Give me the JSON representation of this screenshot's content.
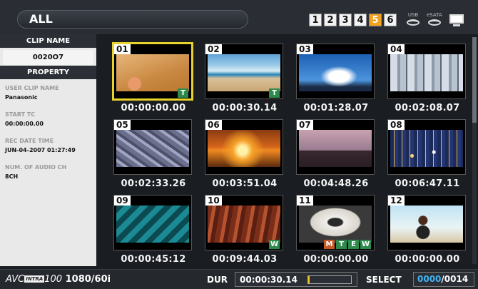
{
  "header": {
    "mode_label": "ALL",
    "slots": [
      {
        "label": "1",
        "active": false
      },
      {
        "label": "2",
        "active": false
      },
      {
        "label": "3",
        "active": false
      },
      {
        "label": "4",
        "active": false
      },
      {
        "label": "5",
        "active": true
      },
      {
        "label": "6",
        "active": false
      }
    ],
    "usb_label": "USB",
    "esata_label": "eSATA"
  },
  "left_panel": {
    "clip_name_header": "CLIP NAME",
    "clip_name_value": "0020O7",
    "property_header": "PROPERTY",
    "properties": [
      {
        "key": "USER CLIP NAME",
        "value": "Panasonic"
      },
      {
        "key": "START TC",
        "value": "00:00:00.00"
      },
      {
        "key": "REC DATE TIME",
        "value": "JUN-04-2007 01:27:49"
      },
      {
        "key": "NUM. OF AUDIO CH",
        "value": "8CH"
      }
    ]
  },
  "clips": [
    {
      "num": "01",
      "timecode": "00:00:00.00",
      "badges": [
        "T"
      ],
      "selected": true
    },
    {
      "num": "02",
      "timecode": "00:00:30.14",
      "badges": [
        "T"
      ],
      "selected": false
    },
    {
      "num": "03",
      "timecode": "00:01:28.07",
      "badges": [],
      "selected": false
    },
    {
      "num": "04",
      "timecode": "00:02:08.07",
      "badges": [],
      "selected": false
    },
    {
      "num": "05",
      "timecode": "00:02:33.26",
      "badges": [],
      "selected": false
    },
    {
      "num": "06",
      "timecode": "00:03:51.04",
      "badges": [],
      "selected": false
    },
    {
      "num": "07",
      "timecode": "00:04:48.26",
      "badges": [],
      "selected": false
    },
    {
      "num": "08",
      "timecode": "00:06:47.11",
      "badges": [],
      "selected": false
    },
    {
      "num": "09",
      "timecode": "00:00:45:12",
      "badges": [],
      "selected": false
    },
    {
      "num": "10",
      "timecode": "00:09:44.03",
      "badges": [
        "W"
      ],
      "selected": false
    },
    {
      "num": "11",
      "timecode": "00:00:00.00",
      "badges": [
        "M",
        "T",
        "E",
        "W"
      ],
      "selected": false
    },
    {
      "num": "12",
      "timecode": "00:00:00.00",
      "badges": [],
      "selected": false
    }
  ],
  "footer": {
    "format_avc": "AVC",
    "format_intra": "INTRA",
    "format_100": "100",
    "format_res": "1080/60i",
    "dur_label": "DUR",
    "dur_value": "00:00:30.14",
    "dur_progress": 0.03,
    "select_label": "SELECT",
    "select_count": "0000",
    "select_total": "/0014"
  },
  "colors": {
    "selected_border": "#e8d22b",
    "slot_active": "#f2a21b",
    "select_count": "#3fb3f5",
    "badge_green": "#2e8a4c",
    "badge_orange": "#c75a28"
  }
}
